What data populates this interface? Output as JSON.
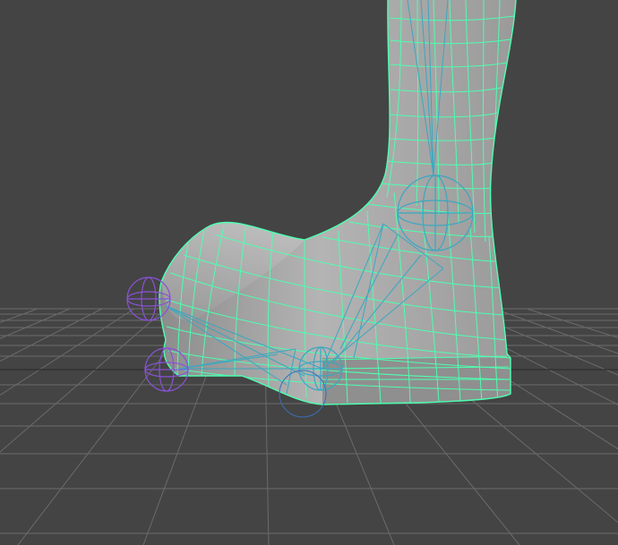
{
  "viewport": {
    "background": "#444444",
    "grid_color": "#6e6e6e",
    "model_fill": "#a9a9a9",
    "wireframe_color": "#4dffb0",
    "ik_color": "#3aa7c0",
    "control_color": "#8a52d6"
  },
  "icons": {
    "foot_root_control": "ik-joint-icon",
    "toe_control": "ik-handle-icon",
    "heel_control": "ik-handle-icon",
    "ball_joint": "ik-joint-icon"
  }
}
